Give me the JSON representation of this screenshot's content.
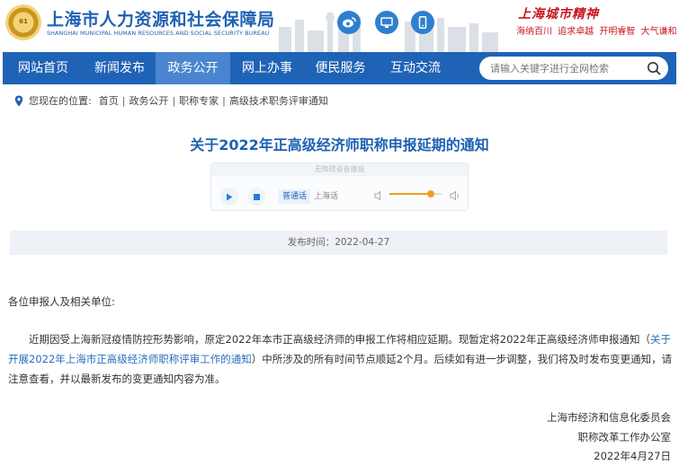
{
  "header": {
    "title_cn": "上海市人力资源和社会保障局",
    "title_en": "SHANGHAI MUNICIPAL HUMAN RESOURCES AND SOCIAL SECURITY BUREAU",
    "logo_text": "61",
    "social_icons": [
      "weibo-icon",
      "desktop-icon",
      "mobile-icon"
    ],
    "spirit_title": "上海城市精神",
    "spirit_words": "海纳百川 追求卓越 开明睿智 大气谦和"
  },
  "nav": {
    "items": [
      "网站首页",
      "新闻发布",
      "政务公开",
      "网上办事",
      "便民服务",
      "互动交流"
    ],
    "active_index": 2
  },
  "search": {
    "placeholder": "请输入关键字进行全网检索"
  },
  "breadcrumb": {
    "label": "您现在的位置:",
    "items": [
      "首页",
      "政务公开",
      "职称专家",
      "高级技术职务评审通知"
    ]
  },
  "article": {
    "title": "关于2022年正高级经济师职称申报延期的通知",
    "player": {
      "label": "无障碍语音播报",
      "tab_mandarin": "普通话",
      "tab_shanghainese": "上海话",
      "volume": 0.8
    },
    "publish": "发布时间：2022-04-27",
    "salutation": "各位申报人及相关单位:",
    "para_before": "近期因受上海新冠疫情防控形势影响，原定2022年本市正高级经济师的申报工作将相应延期。现暂定将2022年正高级经济师申报通知（",
    "para_link": "关于开展2022年上海市正高级经济师职称评审工作的通知",
    "para_after": "）中所涉及的所有时间节点顺延2个月。后续如有进一步调整，我们将及时发布变更通知，请注意查看，并以最新发布的变更通知内容为准。",
    "sign_org1": "上海市经济和信息化委员会",
    "sign_org2": "职称改革工作办公室",
    "sign_date": "2022年4月27日"
  },
  "colors": {
    "brand_blue": "#1f63b6",
    "nav_active": "#4a86cf",
    "spirit_red": "#c8161e",
    "volume_orange": "#f29c1f"
  }
}
